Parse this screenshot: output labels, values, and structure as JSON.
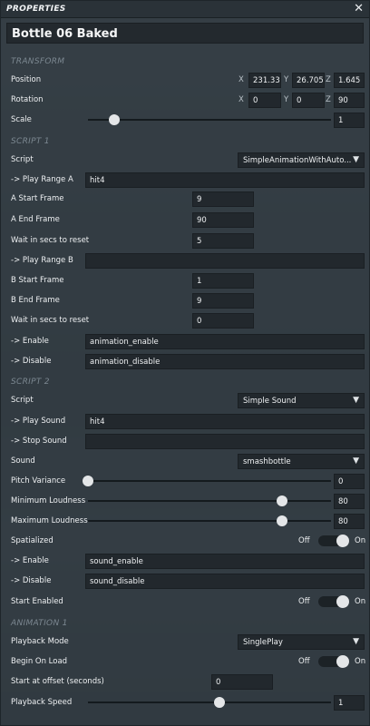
{
  "window": {
    "title": "PROPERTIES",
    "close_glyph": "✕"
  },
  "object_name": "Bottle 06 Baked",
  "transform": {
    "section_label": "TRANSFORM",
    "position": {
      "label": "Position",
      "x": "231.331",
      "y": "26.705",
      "z": "1.645"
    },
    "rotation": {
      "label": "Rotation",
      "x": "0",
      "y": "0",
      "z": "90"
    },
    "scale": {
      "label": "Scale",
      "value": "1",
      "slider_fraction": 0.11
    },
    "axis_labels": {
      "x": "X",
      "y": "Y",
      "z": "Z"
    }
  },
  "script1": {
    "section_label": "SCRIPT 1",
    "script": {
      "label": "Script",
      "value": "SimpleAnimationWithAuto..."
    },
    "play_range_a": {
      "label": "-> Play Range A",
      "value": "hit4"
    },
    "a_start_frame": {
      "label": "A Start Frame",
      "value": "9"
    },
    "a_end_frame": {
      "label": "A End Frame",
      "value": "90"
    },
    "wait_a": {
      "label": "Wait in secs to reset",
      "value": "5"
    },
    "play_range_b": {
      "label": "-> Play Range B",
      "value": ""
    },
    "b_start_frame": {
      "label": "B Start Frame",
      "value": "1"
    },
    "b_end_frame": {
      "label": "B End Frame",
      "value": "9"
    },
    "wait_b": {
      "label": "Wait in secs to reset",
      "value": "0"
    },
    "enable": {
      "label": "-> Enable",
      "value": "animation_enable"
    },
    "disable": {
      "label": "-> Disable",
      "value": "animation_disable"
    }
  },
  "script2": {
    "section_label": "SCRIPT 2",
    "script": {
      "label": "Script",
      "value": "Simple Sound"
    },
    "play_sound": {
      "label": "-> Play Sound",
      "value": "hit4"
    },
    "stop_sound": {
      "label": "-> Stop Sound",
      "value": ""
    },
    "sound": {
      "label": "Sound",
      "value": "smashbottle"
    },
    "pitch_variance": {
      "label": "Pitch Variance",
      "value": "0",
      "slider_fraction": 0.0
    },
    "min_loudness": {
      "label": "Minimum Loudness",
      "value": "80",
      "slider_fraction": 0.8
    },
    "max_loudness": {
      "label": "Maximum Loudness",
      "value": "80",
      "slider_fraction": 0.8
    },
    "spatialized": {
      "label": "Spatialized",
      "off": "Off",
      "on": "On",
      "state": "On"
    },
    "enable": {
      "label": "-> Enable",
      "value": "sound_enable"
    },
    "disable": {
      "label": "-> Disable",
      "value": "sound_disable"
    },
    "start_enabled": {
      "label": "Start Enabled",
      "off": "Off",
      "on": "On",
      "state": "On"
    }
  },
  "animation1": {
    "section_label": "ANIMATION 1",
    "playback_mode": {
      "label": "Playback Mode",
      "value": "SinglePlay"
    },
    "begin_on_load": {
      "label": "Begin On Load",
      "off": "Off",
      "on": "On",
      "state": "On"
    },
    "start_offset": {
      "label": "Start at offset (seconds)",
      "value": "0"
    },
    "playback_speed": {
      "label": "Playback Speed",
      "value": "1",
      "slider_fraction": 0.54
    }
  },
  "icons": {
    "dropdown": "chevron-down-icon",
    "close": "close-icon"
  },
  "colors": {
    "panel_bg": "#30383f",
    "field_bg": "#22282d",
    "section_text": "#7c8891",
    "knob": "#e4e6e8"
  }
}
